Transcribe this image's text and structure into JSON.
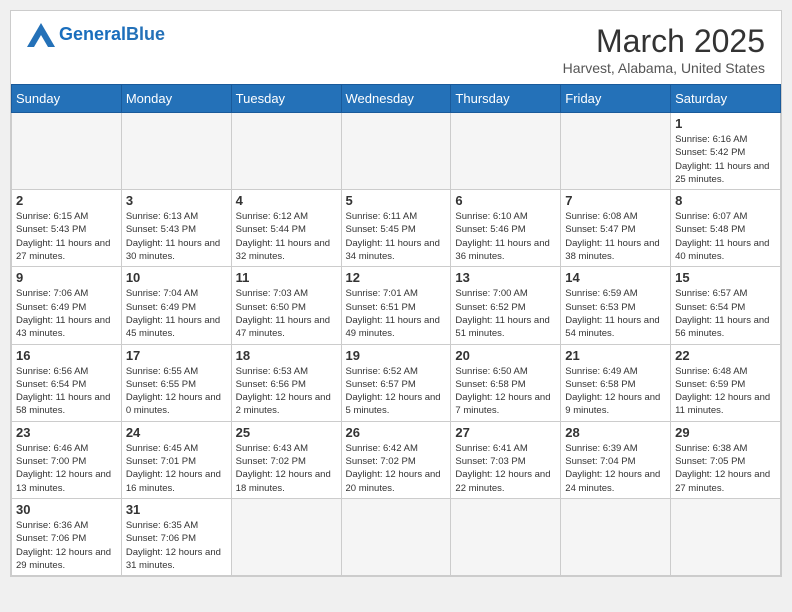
{
  "header": {
    "logo_general": "General",
    "logo_blue": "Blue",
    "month_title": "March 2025",
    "subtitle": "Harvest, Alabama, United States"
  },
  "days_of_week": [
    "Sunday",
    "Monday",
    "Tuesday",
    "Wednesday",
    "Thursday",
    "Friday",
    "Saturday"
  ],
  "weeks": [
    [
      {
        "day": "",
        "info": ""
      },
      {
        "day": "",
        "info": ""
      },
      {
        "day": "",
        "info": ""
      },
      {
        "day": "",
        "info": ""
      },
      {
        "day": "",
        "info": ""
      },
      {
        "day": "",
        "info": ""
      },
      {
        "day": "1",
        "info": "Sunrise: 6:16 AM\nSunset: 5:42 PM\nDaylight: 11 hours and 25 minutes."
      }
    ],
    [
      {
        "day": "2",
        "info": "Sunrise: 6:15 AM\nSunset: 5:43 PM\nDaylight: 11 hours and 27 minutes."
      },
      {
        "day": "3",
        "info": "Sunrise: 6:13 AM\nSunset: 5:43 PM\nDaylight: 11 hours and 30 minutes."
      },
      {
        "day": "4",
        "info": "Sunrise: 6:12 AM\nSunset: 5:44 PM\nDaylight: 11 hours and 32 minutes."
      },
      {
        "day": "5",
        "info": "Sunrise: 6:11 AM\nSunset: 5:45 PM\nDaylight: 11 hours and 34 minutes."
      },
      {
        "day": "6",
        "info": "Sunrise: 6:10 AM\nSunset: 5:46 PM\nDaylight: 11 hours and 36 minutes."
      },
      {
        "day": "7",
        "info": "Sunrise: 6:08 AM\nSunset: 5:47 PM\nDaylight: 11 hours and 38 minutes."
      },
      {
        "day": "8",
        "info": "Sunrise: 6:07 AM\nSunset: 5:48 PM\nDaylight: 11 hours and 40 minutes."
      }
    ],
    [
      {
        "day": "9",
        "info": "Sunrise: 7:06 AM\nSunset: 6:49 PM\nDaylight: 11 hours and 43 minutes."
      },
      {
        "day": "10",
        "info": "Sunrise: 7:04 AM\nSunset: 6:49 PM\nDaylight: 11 hours and 45 minutes."
      },
      {
        "day": "11",
        "info": "Sunrise: 7:03 AM\nSunset: 6:50 PM\nDaylight: 11 hours and 47 minutes."
      },
      {
        "day": "12",
        "info": "Sunrise: 7:01 AM\nSunset: 6:51 PM\nDaylight: 11 hours and 49 minutes."
      },
      {
        "day": "13",
        "info": "Sunrise: 7:00 AM\nSunset: 6:52 PM\nDaylight: 11 hours and 51 minutes."
      },
      {
        "day": "14",
        "info": "Sunrise: 6:59 AM\nSunset: 6:53 PM\nDaylight: 11 hours and 54 minutes."
      },
      {
        "day": "15",
        "info": "Sunrise: 6:57 AM\nSunset: 6:54 PM\nDaylight: 11 hours and 56 minutes."
      }
    ],
    [
      {
        "day": "16",
        "info": "Sunrise: 6:56 AM\nSunset: 6:54 PM\nDaylight: 11 hours and 58 minutes."
      },
      {
        "day": "17",
        "info": "Sunrise: 6:55 AM\nSunset: 6:55 PM\nDaylight: 12 hours and 0 minutes."
      },
      {
        "day": "18",
        "info": "Sunrise: 6:53 AM\nSunset: 6:56 PM\nDaylight: 12 hours and 2 minutes."
      },
      {
        "day": "19",
        "info": "Sunrise: 6:52 AM\nSunset: 6:57 PM\nDaylight: 12 hours and 5 minutes."
      },
      {
        "day": "20",
        "info": "Sunrise: 6:50 AM\nSunset: 6:58 PM\nDaylight: 12 hours and 7 minutes."
      },
      {
        "day": "21",
        "info": "Sunrise: 6:49 AM\nSunset: 6:58 PM\nDaylight: 12 hours and 9 minutes."
      },
      {
        "day": "22",
        "info": "Sunrise: 6:48 AM\nSunset: 6:59 PM\nDaylight: 12 hours and 11 minutes."
      }
    ],
    [
      {
        "day": "23",
        "info": "Sunrise: 6:46 AM\nSunset: 7:00 PM\nDaylight: 12 hours and 13 minutes."
      },
      {
        "day": "24",
        "info": "Sunrise: 6:45 AM\nSunset: 7:01 PM\nDaylight: 12 hours and 16 minutes."
      },
      {
        "day": "25",
        "info": "Sunrise: 6:43 AM\nSunset: 7:02 PM\nDaylight: 12 hours and 18 minutes."
      },
      {
        "day": "26",
        "info": "Sunrise: 6:42 AM\nSunset: 7:02 PM\nDaylight: 12 hours and 20 minutes."
      },
      {
        "day": "27",
        "info": "Sunrise: 6:41 AM\nSunset: 7:03 PM\nDaylight: 12 hours and 22 minutes."
      },
      {
        "day": "28",
        "info": "Sunrise: 6:39 AM\nSunset: 7:04 PM\nDaylight: 12 hours and 24 minutes."
      },
      {
        "day": "29",
        "info": "Sunrise: 6:38 AM\nSunset: 7:05 PM\nDaylight: 12 hours and 27 minutes."
      }
    ],
    [
      {
        "day": "30",
        "info": "Sunrise: 6:36 AM\nSunset: 7:06 PM\nDaylight: 12 hours and 29 minutes."
      },
      {
        "day": "31",
        "info": "Sunrise: 6:35 AM\nSunset: 7:06 PM\nDaylight: 12 hours and 31 minutes."
      },
      {
        "day": "",
        "info": ""
      },
      {
        "day": "",
        "info": ""
      },
      {
        "day": "",
        "info": ""
      },
      {
        "day": "",
        "info": ""
      },
      {
        "day": "",
        "info": ""
      }
    ]
  ]
}
